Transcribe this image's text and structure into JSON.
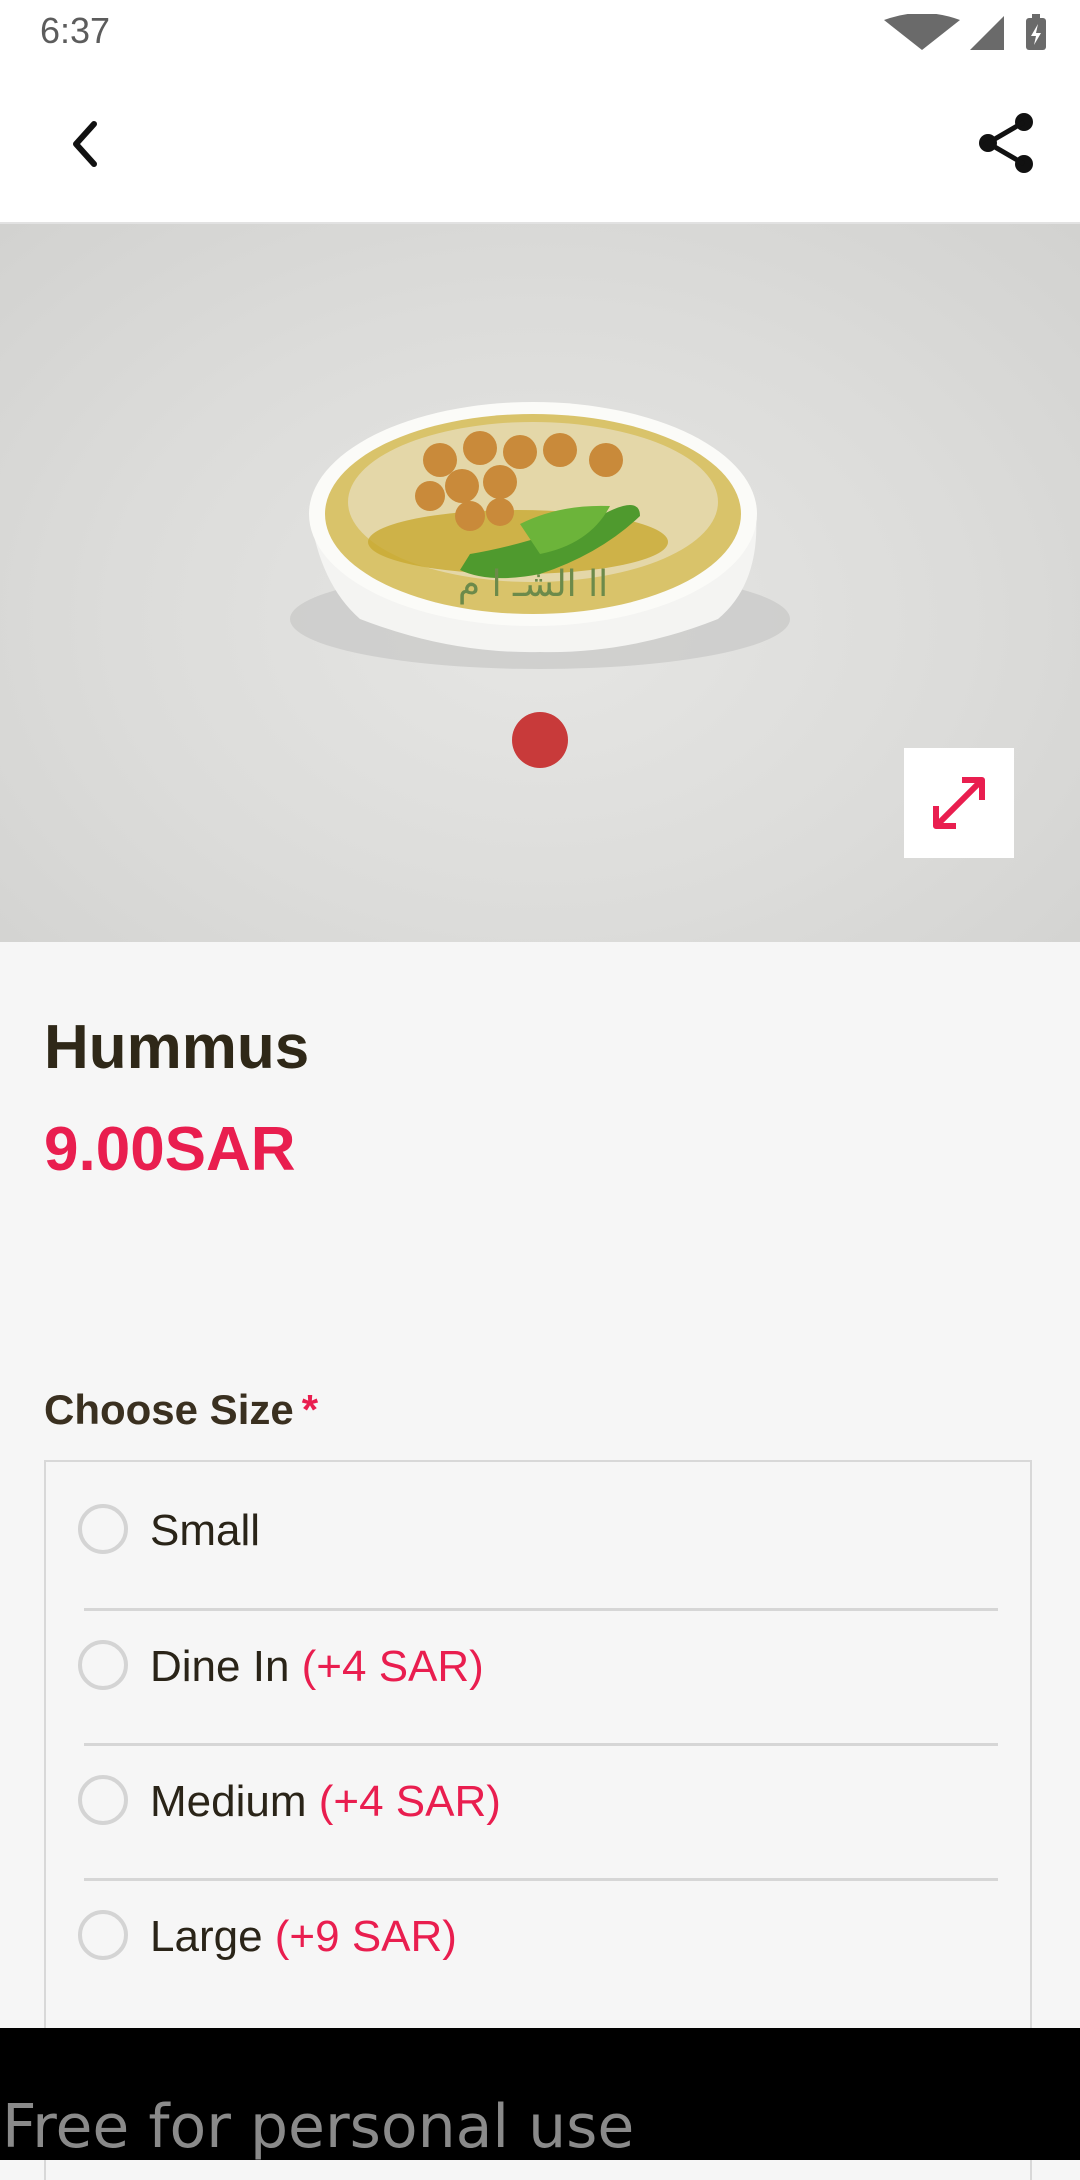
{
  "status_bar": {
    "time": "6:37"
  },
  "product": {
    "name": "Hummus",
    "price": "9.00SAR"
  },
  "options_section": {
    "label": "Choose Size",
    "required_marker": "*",
    "options": [
      {
        "label": "Small",
        "extra": ""
      },
      {
        "label": "Dine In",
        "extra": "(+4 SAR)"
      },
      {
        "label": "Medium",
        "extra": "(+4 SAR)"
      },
      {
        "label": "Large",
        "extra": "(+9 SAR)"
      }
    ]
  },
  "footer": {
    "text": "Free for personal use"
  },
  "icons": {
    "back": "chevron-left-icon",
    "share": "share-icon",
    "expand": "expand-diagonal-icon",
    "wifi": "wifi-icon",
    "signal": "cell-signal-icon",
    "battery": "battery-icon"
  },
  "colors": {
    "accent": "#e91e4f",
    "title": "#2f2818",
    "background": "#f6f6f6"
  }
}
